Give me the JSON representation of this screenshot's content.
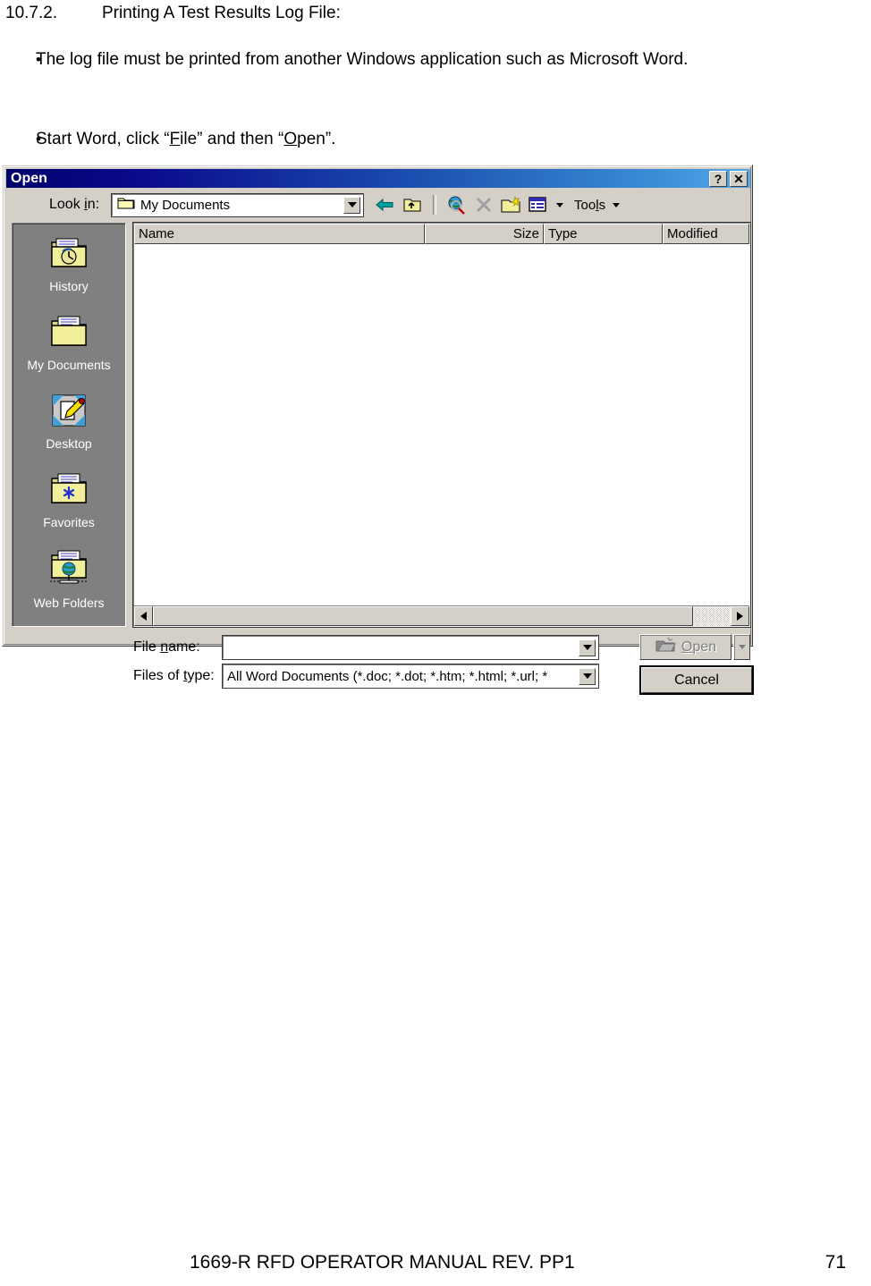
{
  "document": {
    "heading": {
      "number": "10.7.2.",
      "text": "Printing A Test Results Log File:"
    },
    "bullets": [
      {
        "marker": "•",
        "text": "The log file must be printed from another Windows application such as Microsoft Word."
      },
      {
        "marker": "•",
        "text": "Start Word, click “File” and then “Open”."
      }
    ]
  },
  "dialog": {
    "titlebar": {
      "title": "Open",
      "help_label": "?",
      "close_label": "✕"
    },
    "lookin": {
      "label": "Look in:",
      "value": "My Documents",
      "icon": "folder-icon"
    },
    "toolbar": {
      "back_icon": "back-arrow-icon",
      "up_icon": "up-one-level-icon",
      "search_icon": "search-web-icon",
      "delete_icon": "delete-x-icon",
      "new_folder_icon": "new-folder-icon",
      "views_icon": "views-icon",
      "views_arrow_icon": "chevron-down-icon",
      "tools_label": "Tools",
      "tools_arrow_icon": "chevron-down-icon"
    },
    "places": [
      {
        "label": "History",
        "icon": "history-folder-icon"
      },
      {
        "label": "My Documents",
        "icon": "my-documents-folder-icon"
      },
      {
        "label": "Desktop",
        "icon": "desktop-icon"
      },
      {
        "label": "Favorites",
        "icon": "favorites-folder-icon"
      },
      {
        "label": "Web Folders",
        "icon": "web-folders-icon"
      }
    ],
    "filelist": {
      "columns": [
        {
          "label": "Name",
          "align": "left"
        },
        {
          "label": "Size",
          "align": "right"
        },
        {
          "label": "Type",
          "align": "left"
        },
        {
          "label": "Modified",
          "align": "left"
        }
      ],
      "rows": []
    },
    "scrollbar": {
      "left_arrow_icon": "scroll-left-arrow-icon",
      "right_arrow_icon": "scroll-right-arrow-icon"
    },
    "form": {
      "filename_label": "File name:",
      "filename_value": "",
      "filename_placeholder": "",
      "filetype_label": "Files of type:",
      "filetype_value": "All Word Documents (*.doc; *.dot; *.htm; *.html; *.url; *"
    },
    "buttons": {
      "open_label": "Open",
      "open_icon": "open-folder-icon",
      "open_disabled": true,
      "open_split_arrow_icon": "chevron-down-icon",
      "cancel_label": "Cancel"
    }
  },
  "footer": {
    "title": "1669-R RFD OPERATOR MANUAL REV. PP1",
    "page": "71"
  },
  "colors": {
    "dialog_face": "#d4d0c8",
    "titlebar_start": "#00006b",
    "titlebar_end": "#54a8e8",
    "placesbar": "#808080",
    "folder_yellow": "#f2ef9c",
    "folder_outline": "#000000"
  }
}
